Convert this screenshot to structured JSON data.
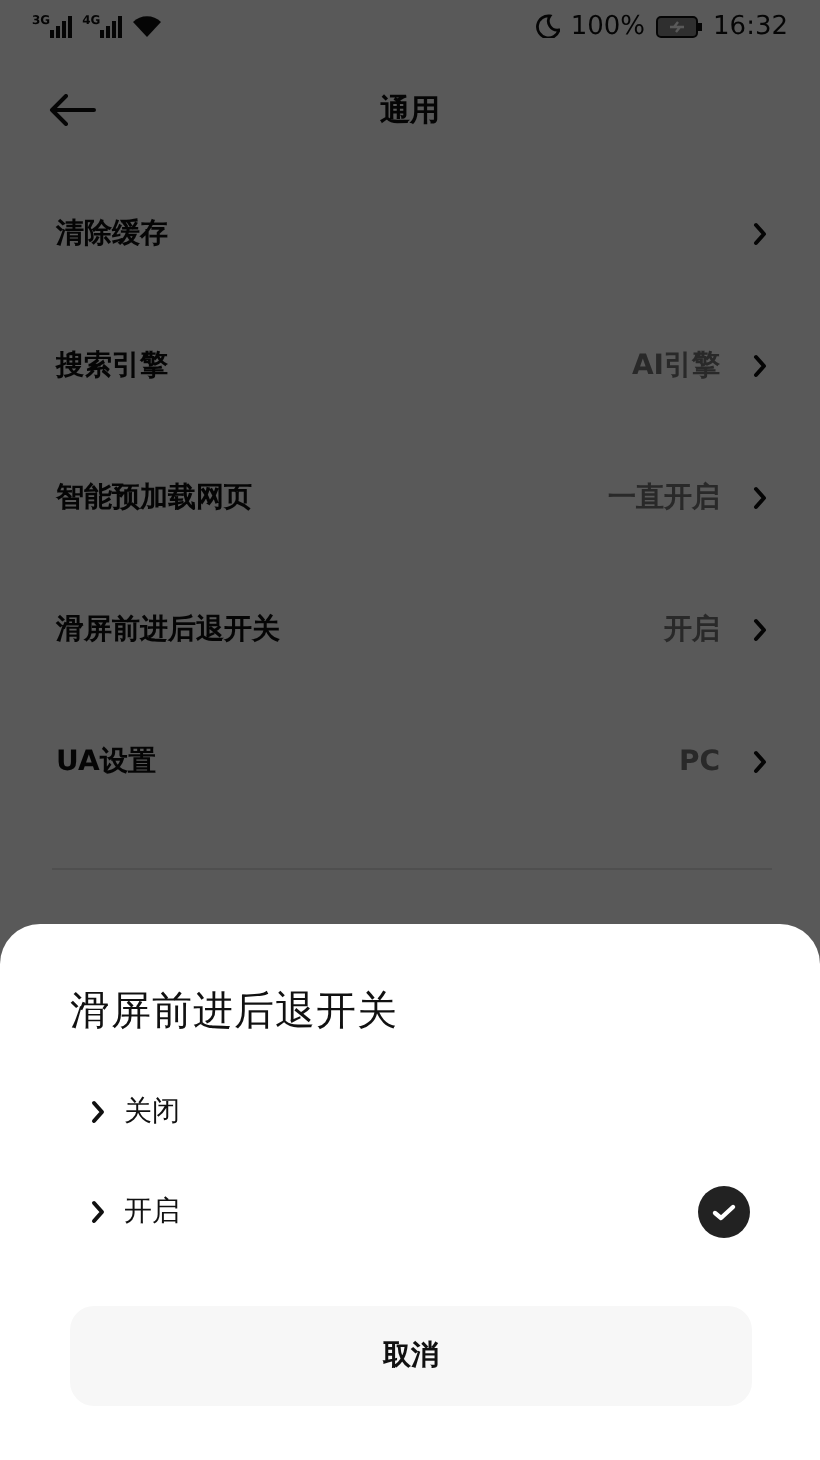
{
  "status_bar": {
    "network_1": "3G",
    "network_2": "4G",
    "battery": "100%",
    "time": "16:32"
  },
  "header": {
    "title": "通用"
  },
  "settings": [
    {
      "label": "清除缓存"
    },
    {
      "label": "搜索引擎",
      "value": "AI引擎"
    },
    {
      "label": "智能预加载网页",
      "value": "一直开启"
    },
    {
      "label": "滑屏前进后退开关",
      "value": "开启"
    },
    {
      "label": "UA设置",
      "value": "PC"
    }
  ],
  "sheet": {
    "title": "滑屏前进后退开关",
    "options": [
      {
        "label": "关闭",
        "selected": false
      },
      {
        "label": "开启",
        "selected": true
      }
    ],
    "cancel": "取消"
  }
}
